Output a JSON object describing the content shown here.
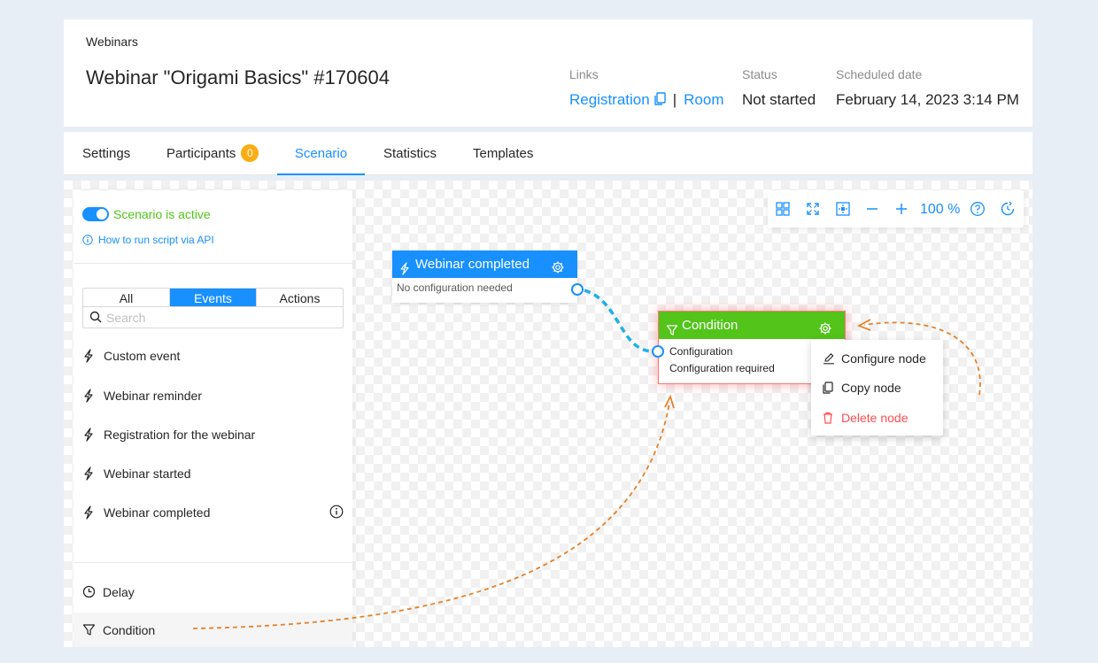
{
  "header": {
    "breadcrumb": "Webinars",
    "title": "Webinar \"Origami Basics\" #170604",
    "links_label": "Links",
    "registration_link": "Registration",
    "separator": "|",
    "room_link": "Room",
    "status_label": "Status",
    "status_value": "Not started",
    "date_label": "Scheduled date",
    "date_value": "February 14, 2023 3:14 PM"
  },
  "tabs": [
    {
      "label": "Settings"
    },
    {
      "label": "Participants",
      "badge": "0"
    },
    {
      "label": "Scenario",
      "active": true
    },
    {
      "label": "Statistics"
    },
    {
      "label": "Templates"
    }
  ],
  "sidebar": {
    "toggle_label": "Scenario is active",
    "api_link": "How to run script via API",
    "filters": [
      "All",
      "Events",
      "Actions"
    ],
    "active_filter": "Events",
    "search_placeholder": "Search",
    "events": [
      {
        "label": "Custom event",
        "icon": "lightning-icon"
      },
      {
        "label": "Webinar reminder",
        "icon": "lightning-icon"
      },
      {
        "label": "Registration for the webinar",
        "icon": "lightning-icon"
      },
      {
        "label": "Webinar started",
        "icon": "lightning-icon"
      },
      {
        "label": "Webinar completed",
        "icon": "lightning-icon"
      }
    ],
    "actions": [
      {
        "label": "Delay",
        "icon": "clock-icon"
      },
      {
        "label": "Condition",
        "icon": "filter-icon"
      }
    ]
  },
  "toolbar": {
    "zoom": "100 %",
    "icons": [
      "grid-icon",
      "fullscreen-icon",
      "fit-icon",
      "zoom-out-icon",
      "zoom-in-icon",
      "help-icon",
      "history-icon"
    ]
  },
  "nodes": {
    "webinar_completed": {
      "title": "Webinar completed",
      "body": "No configuration needed",
      "color": "#1890ff"
    },
    "condition": {
      "title": "Condition",
      "body_line1": "Configuration",
      "body_line2": "Configuration required",
      "color": "#52c41a"
    }
  },
  "context_menu": {
    "configure": "Configure node",
    "copy": "Copy node",
    "delete": "Delete node"
  },
  "colors": {
    "accent": "#1890ff",
    "success": "#52c41a",
    "danger": "#ff4d4f",
    "badge": "#faad14",
    "annotation": "#e8812a"
  }
}
